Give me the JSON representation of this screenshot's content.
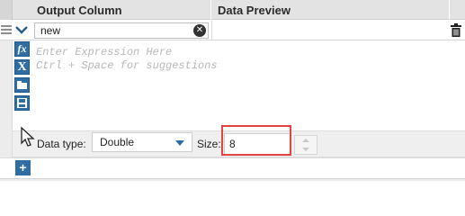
{
  "header": {
    "col_output": "Output Column",
    "col_preview": "Data Preview"
  },
  "row": {
    "name_value": "new"
  },
  "expression": {
    "placeholder_line1": "Enter Expression Here",
    "placeholder_line2": "Ctrl + Space for suggestions"
  },
  "toolbar": {
    "fx_glyph": "fx",
    "x_glyph": "X",
    "icons": [
      "function-icon",
      "variable-icon",
      "open-folder-icon",
      "save-icon"
    ]
  },
  "type_bar": {
    "type_label": "Data type:",
    "type_value": "Double",
    "size_label": "Size:",
    "size_value": "8"
  },
  "colors": {
    "accent": "#2f6ea3",
    "highlight": "#e0463f"
  }
}
